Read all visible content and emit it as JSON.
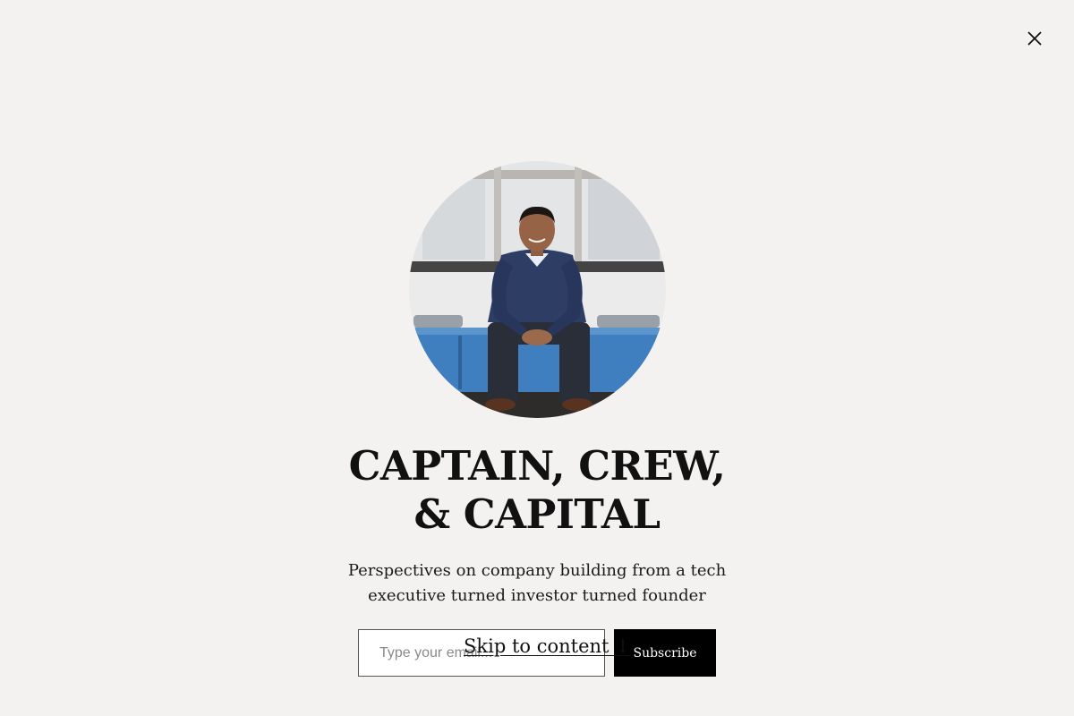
{
  "modal": {
    "close_icon": "close-icon",
    "title_line1": "CAPTAIN, CREW,",
    "title_line2": "& CAPITAL",
    "subtitle_line1": "Perspectives on company building from a tech",
    "subtitle_line2": "executive turned investor turned founder"
  },
  "signup": {
    "email_placeholder": "Type your email...",
    "subscribe_label": "Subscribe"
  },
  "skip_link": {
    "label": "Skip to content ↓"
  },
  "colors": {
    "background": "#f4f2f0",
    "button": "#000000",
    "text": "#111111",
    "chair_blue": "#3f7fbf",
    "sweater_navy": "#2d3d63"
  }
}
